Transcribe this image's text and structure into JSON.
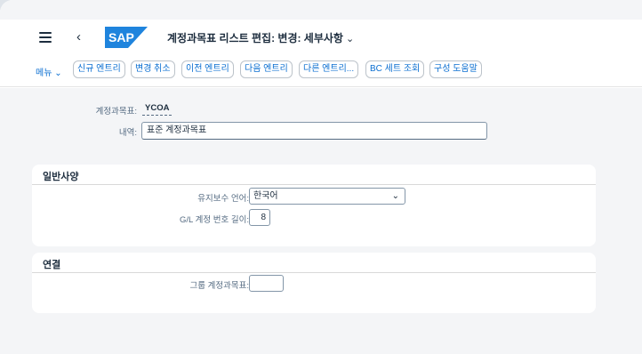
{
  "header": {
    "app_title": "계정과목표 리스트 편집: 변경: 세부사항",
    "logo_text": "SAP"
  },
  "toolbar": {
    "menu_label": "메뉴",
    "buttons": [
      "신규 엔트리",
      "변경 취소",
      "이전 엔트리",
      "다음 엔트리",
      "다른 엔트리...",
      "BC 세트 조회",
      "구성 도움말"
    ]
  },
  "form": {
    "chart_label": "계정과목표:",
    "chart_value": "YCOA",
    "desc_label": "내역:",
    "desc_value": "표준 계정과목표"
  },
  "general": {
    "title": "일반사양",
    "language_label": "유지보수 언어:",
    "language_value": "한국어",
    "gl_length_label": "G/L 계정 번호 길이:",
    "gl_length_value": "8"
  },
  "link": {
    "title": "연결",
    "group_label": "그룹 계정과목표:",
    "group_value": ""
  },
  "colors": {
    "accent": "#0a6ed1",
    "logo": "#0a6ed1"
  }
}
